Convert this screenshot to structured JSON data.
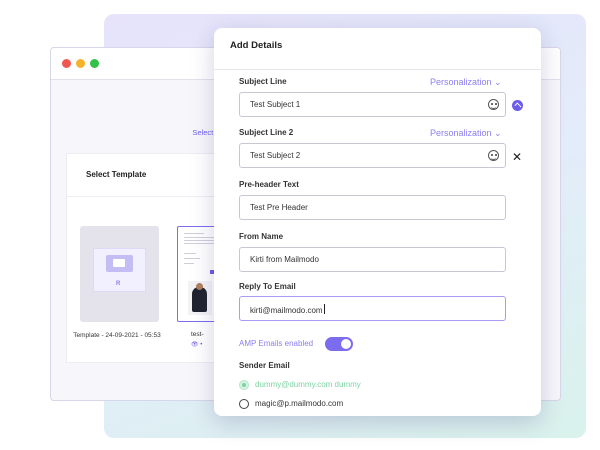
{
  "background_window": {
    "stepper": {
      "active_step_label": "Select Template"
    },
    "template_panel": {
      "title": "Select Template",
      "templates": [
        {
          "caption": "Template - 24-09-2021 - 05:53",
          "logo_glyph": "R"
        },
        {
          "caption": "test-",
          "view_glyph": "👁 •"
        }
      ]
    }
  },
  "modal": {
    "title": "Add Details",
    "subject_line": {
      "label": "Subject Line",
      "value": "Test Subject 1",
      "personalization": "Personalization ⌄"
    },
    "subject_line_2": {
      "label": "Subject Line 2",
      "value": "Test Subject 2",
      "personalization": "Personalization ⌄",
      "remove_glyph": "✕"
    },
    "preheader": {
      "label": "Pre-header Text",
      "value": "Test Pre Header"
    },
    "from_name": {
      "label": "From Name",
      "value": "Kirti from Mailmodo"
    },
    "reply_to": {
      "label": "Reply To Email",
      "value": "kirti@mailmodo.com"
    },
    "amp": {
      "label": "AMP Emails enabled",
      "enabled": true
    },
    "sender_email": {
      "label": "Sender Email",
      "options": [
        {
          "text": "dummy@dummy.com dummy",
          "selected": true
        },
        {
          "text": "magic@p.mailmodo.com",
          "selected": false
        }
      ]
    }
  },
  "colors": {
    "accent": "#6c5ce7",
    "personalization_text": "#8c7ff0",
    "selected_option_text": "#7fd3a3",
    "bg_gradient": [
      "#e6e3fb",
      "#d9f2ec"
    ]
  }
}
